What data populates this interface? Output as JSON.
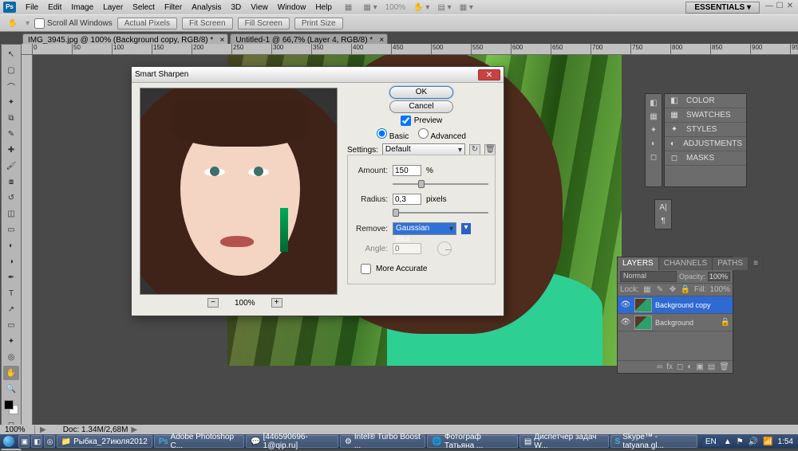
{
  "menu": {
    "items": [
      "File",
      "Edit",
      "Image",
      "Layer",
      "Select",
      "Filter",
      "Analysis",
      "3D",
      "View",
      "Window",
      "Help"
    ],
    "essentials": "ESSENTIALS"
  },
  "options": {
    "scrollAll": "Scroll All Windows",
    "btns": [
      "Actual Pixels",
      "Fit Screen",
      "Fill Screen",
      "Print Size"
    ],
    "zoom": "100%"
  },
  "tabs": [
    {
      "label": "IMG_3945.jpg @ 100% (Background copy, RGB/8) *",
      "active": true
    },
    {
      "label": "Untitled-1 @ 66,7% (Layer 4, RGB/8) *",
      "active": false
    }
  ],
  "dialog": {
    "title": "Smart Sharpen",
    "ok": "OK",
    "cancel": "Cancel",
    "preview": "Preview",
    "basic": "Basic",
    "advanced": "Advanced",
    "settings_label": "Settings:",
    "settings_value": "Default",
    "amount_label": "Amount:",
    "amount_value": "150",
    "amount_unit": "%",
    "radius_label": "Radius:",
    "radius_value": "0,3",
    "radius_unit": "pixels",
    "remove_label": "Remove:",
    "remove_value": "Gaussian Blur",
    "angle_label": "Angle:",
    "angle_value": "0",
    "more_accurate": "More Accurate",
    "zoom": "100%"
  },
  "right_panels": {
    "items": [
      "COLOR",
      "SWATCHES",
      "STYLES",
      "ADJUSTMENTS",
      "MASKS"
    ]
  },
  "layers": {
    "tabs": [
      "LAYERS",
      "CHANNELS",
      "PATHS"
    ],
    "mode": "Normal",
    "opacity_label": "Opacity:",
    "opacity": "100%",
    "lock_label": "Lock:",
    "fill_label": "Fill:",
    "fill": "100%",
    "rows": [
      {
        "name": "Background copy",
        "selected": true,
        "locked": false
      },
      {
        "name": "Background",
        "selected": false,
        "locked": true
      }
    ]
  },
  "status": {
    "zoom": "100%",
    "doc": "Doc: 1.34M/2,68M"
  },
  "taskbar": {
    "items": [
      "Рыбка_27июля2012",
      "Adobe Photoshop C...",
      "[446590696-1@qip.ru]",
      "Intel® Turbo Boost ...",
      "Фотограф Татьяна ...",
      "Диспетчер задач W...",
      "Skype™ - tatyana.gl..."
    ],
    "lang": "EN",
    "time": "1:54"
  }
}
